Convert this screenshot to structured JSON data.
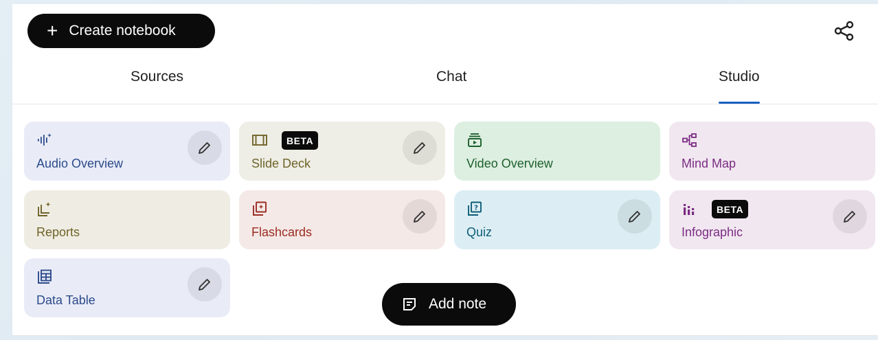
{
  "header": {
    "create_label": "Create notebook",
    "create_icon": "plus-icon",
    "share_icon": "share-icon"
  },
  "tabs": [
    {
      "label": "Sources",
      "active": false
    },
    {
      "label": "Chat",
      "active": false
    },
    {
      "label": "Studio",
      "active": true
    }
  ],
  "studio": {
    "cards": [
      {
        "label": "Audio Overview",
        "icon": "audio-waveform-icon",
        "beta": "",
        "editable": true,
        "bg": "#e9ecf7",
        "fg": "#2c4a8a"
      },
      {
        "label": "Slide Deck",
        "icon": "slides-icon",
        "beta": "BETA",
        "editable": true,
        "bg": "#eeeee6",
        "fg": "#6f6329"
      },
      {
        "label": "Video Overview",
        "icon": "video-icon",
        "beta": "",
        "editable": false,
        "bg": "#ddefe1",
        "fg": "#1e5f2c"
      },
      {
        "label": "Mind Map",
        "icon": "mind-map-icon",
        "beta": "",
        "editable": false,
        "bg": "#f1e7f0",
        "fg": "#7b2c84"
      },
      {
        "label": "Reports",
        "icon": "reports-icon",
        "beta": "",
        "editable": false,
        "bg": "#efede3",
        "fg": "#6f6329"
      },
      {
        "label": "Flashcards",
        "icon": "flashcards-icon",
        "beta": "",
        "editable": true,
        "bg": "#f5e9e7",
        "fg": "#9a2c22"
      },
      {
        "label": "Quiz",
        "icon": "quiz-icon",
        "beta": "",
        "editable": true,
        "bg": "#dceef4",
        "fg": "#0d5d76"
      },
      {
        "label": "Infographic",
        "icon": "infographic-icon",
        "beta": "BETA",
        "editable": true,
        "bg": "#f1e7f0",
        "fg": "#7b2c84"
      },
      {
        "label": "Data Table",
        "icon": "data-table-icon",
        "beta": "",
        "editable": true,
        "bg": "#e9ecf7",
        "fg": "#2c4a8a"
      }
    ]
  },
  "add_note": {
    "label": "Add note",
    "icon": "note-icon"
  }
}
